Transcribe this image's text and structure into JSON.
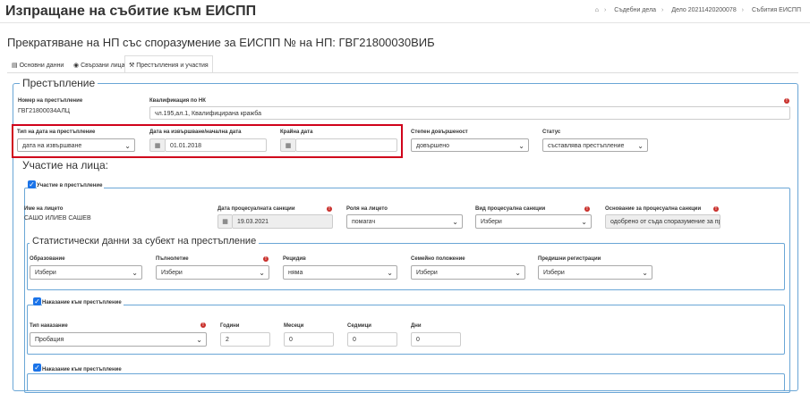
{
  "header": {
    "title": "Изпращане на събитие към ЕИСПП",
    "breadcrumb": [
      "Съдебни дела",
      "Дело 20211420200078",
      "Събития ЕИСПП"
    ]
  },
  "page_title": "Прекратяване на НП със споразумение за ЕИСПП № на НП: ГВГ21800030ВИБ",
  "tabs": [
    {
      "label": "Основни данни",
      "icon": "doc-icon"
    },
    {
      "label": "Свързани лица",
      "icon": "users-icon"
    },
    {
      "label": "Престъпления и участия",
      "icon": "gavel-icon"
    }
  ],
  "crime": {
    "legend": "Престъпление",
    "number_label": "Номер на престъпление",
    "number_value": "ГВГ21800034АЛЦ",
    "qualification_label": "Квалификация по НК",
    "qualification_value": "чл.195,ал.1, Квалифицирана кражба",
    "date_type_label": "Тип на дата на престъпление",
    "date_type_value": "дата на извършване",
    "start_date_label": "Дата на извършване/начална дата",
    "start_date_value": "01.01.2018",
    "end_date_label": "Крайна дата",
    "end_date_value": "",
    "completion_label": "Степен довършеност",
    "completion_value": "довършено",
    "status_label": "Статус",
    "status_value": "съставлява престъпление"
  },
  "participation": {
    "legend": "Участие на лица:",
    "check_label": "Участие в престъпление",
    "person_label": "Име на лицето",
    "person_value": "САШО ИЛИЕВ САШЕВ",
    "proc_date_label": "Дата процесуалната санкции",
    "proc_date_value": "19.03.2021",
    "role_label": "Роля на лицето",
    "role_value": "помагач",
    "sanction_label": "Вид процесуална санкции",
    "sanction_value": "Избери",
    "basis_label": "Основание за процесуална санкции",
    "basis_value": "одобрено от съда споразумение за пр"
  },
  "stats": {
    "legend": "Статистически данни за субект на престъпление",
    "education_label": "Образование",
    "education_value": "Избери",
    "age_label": "Пълнолетие",
    "age_value": "Избери",
    "recidivism_label": "Рецидив",
    "recidivism_value": "няма",
    "family_label": "Семейно положение",
    "family_value": "Избери",
    "prior_label": "Предишни регистрации",
    "prior_value": "Избери"
  },
  "punishment1": {
    "check_label": "Наказание към престъпление",
    "type_label": "Тип наказание",
    "type_value": "Пробация",
    "years_label": "Години",
    "years_value": "2",
    "months_label": "Месеци",
    "months_value": "0",
    "weeks_label": "Седмици",
    "weeks_value": "0",
    "days_label": "Дни",
    "days_value": "0"
  },
  "punishment2": {
    "check_label": "Наказание към престъпление"
  },
  "colors": {
    "accent": "#1a73e8",
    "border_blue": "#6aa6d6",
    "required_red": "#c9302c",
    "highlight_red": "#d0021b"
  }
}
